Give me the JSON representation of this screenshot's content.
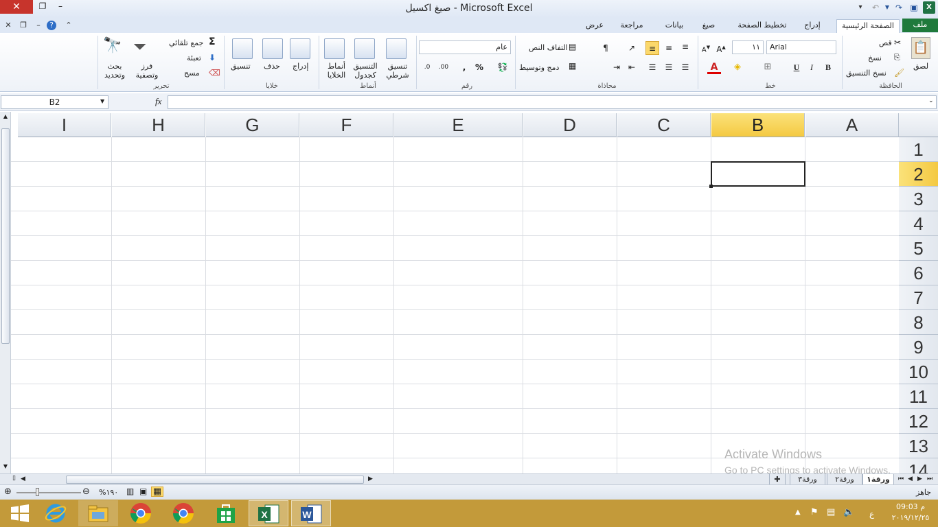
{
  "window": {
    "title": "صيغ اكسيل  - Microsoft Excel",
    "close_icon": "✕",
    "restore_icon": "❐",
    "minimize_icon": "–"
  },
  "tabs": [
    "ملف",
    "الصفحة الرئيسية",
    "إدراج",
    "تخطيط الصفحة",
    "صيغ",
    "بيانات",
    "مراجعة",
    "عرض"
  ],
  "ribbon": {
    "clipboard": {
      "label": "الحافظة",
      "paste": "لصق",
      "cut": "قص",
      "copy": "نسخ",
      "format_painter": "نسخ التنسيق"
    },
    "font": {
      "label": "خط",
      "font_name": "Arial",
      "font_size": "١١",
      "bold": "B",
      "italic": "I",
      "underline": "U"
    },
    "alignment": {
      "label": "محاذاة",
      "wrap_text": "التفاف النص",
      "merge_center": "دمج وتوسيط"
    },
    "number": {
      "label": "رقم",
      "format": "عام",
      "percent": "%",
      "comma": ","
    },
    "styles": {
      "label": "أنماط",
      "conditional": "تنسيق شرطي",
      "format_table": "التنسيق كجدول",
      "cell_styles": "أنماط الخلايا"
    },
    "cells": {
      "label": "خلايا",
      "insert": "إدراج",
      "delete": "حذف",
      "format": "تنسيق"
    },
    "editing": {
      "label": "تحرير",
      "autosum": "جمع تلقائي",
      "fill": "تعبئة",
      "clear": "مسح",
      "sort_filter": "فرز وتصفية",
      "find_select": "بحث وتحديد"
    }
  },
  "formula_bar": {
    "name_box": "B2",
    "fx": "fx",
    "formula": ""
  },
  "grid": {
    "columns": [
      "A",
      "B",
      "C",
      "D",
      "E",
      "F",
      "G",
      "H",
      "I"
    ],
    "selected_column": "B",
    "rows": [
      "1",
      "2",
      "3",
      "4",
      "5",
      "6",
      "7",
      "8",
      "9",
      "10",
      "11",
      "12",
      "13",
      "14"
    ],
    "selected_row": "2",
    "active_cell": "B2"
  },
  "watermark": {
    "line1": "Activate Windows",
    "line2": "Go to PC settings to activate Windows."
  },
  "sheets": [
    "ورقة١",
    "ورقة٢",
    "ورقة٣"
  ],
  "active_sheet": "ورقة١",
  "status": {
    "ready": "جاهز",
    "zoom": "%١٩٠"
  },
  "taskbar": {
    "time": "09:03 م",
    "date": "٢٠١٩/١٢/٢٥",
    "lang": "ع"
  }
}
